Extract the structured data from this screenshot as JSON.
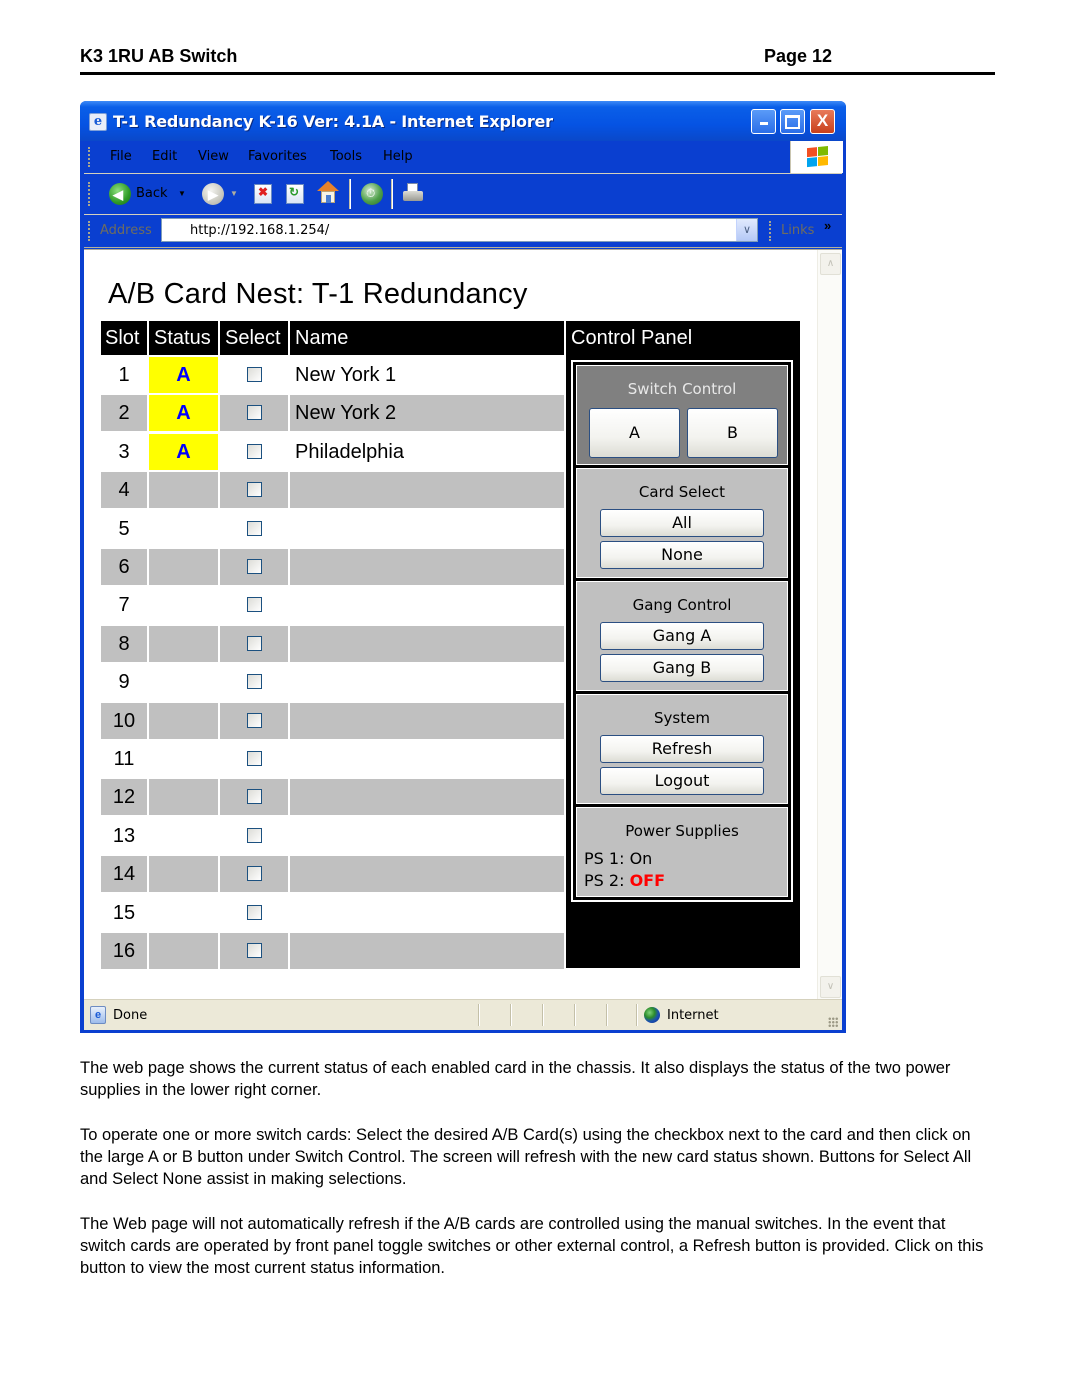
{
  "document": {
    "header_title": "K3 1RU AB Switch",
    "page_label": "Page 12",
    "paragraphs": [
      "The web page shows the current status of each enabled card in the chassis.  It also displays the status of the two power supplies in the lower right corner.",
      "To operate one or more switch cards:  Select the desired A/B Card(s) using the checkbox next to the card and then click on the large A or B button under Switch Control.  The screen will refresh with the new card status shown.  Buttons for Select All and Select None assist in making selections.",
      "The Web page will not automatically refresh if the A/B cards are controlled using the manual switches.  In the event that switch cards are operated by front panel toggle switches or other external control, a Refresh button is provided.  Click on this button to view the most current status information."
    ]
  },
  "browser": {
    "window_title": "T-1 Redundancy K-16 Ver: 4.1A - Internet Explorer",
    "menu": [
      "File",
      "Edit",
      "View",
      "Favorites",
      "Tools",
      "Help"
    ],
    "toolbar": {
      "back_label": "Back",
      "icons": [
        "back-icon",
        "forward-icon",
        "stop-icon",
        "refresh-icon",
        "home-icon",
        "media-icon",
        "print-icon"
      ]
    },
    "address": {
      "label": "Address",
      "value": "http://192.168.1.254/",
      "links_label": "Links",
      "links_chevron": "»"
    },
    "status": {
      "text": "Done",
      "zone": "Internet"
    },
    "window_buttons": {
      "minimize": "_",
      "maximize": "□",
      "close": "X"
    }
  },
  "page": {
    "heading": "A/B Card Nest: T-1 Redundancy",
    "table": {
      "columns": [
        "Slot",
        "Status",
        "Select",
        "Name"
      ],
      "rows": [
        {
          "slot": "1",
          "status": "A",
          "checked": false,
          "name": "New York 1"
        },
        {
          "slot": "2",
          "status": "A",
          "checked": false,
          "name": "New York 2"
        },
        {
          "slot": "3",
          "status": "A",
          "checked": false,
          "name": "Philadelphia"
        },
        {
          "slot": "4",
          "status": "",
          "checked": false,
          "name": ""
        },
        {
          "slot": "5",
          "status": "",
          "checked": false,
          "name": ""
        },
        {
          "slot": "6",
          "status": "",
          "checked": false,
          "name": ""
        },
        {
          "slot": "7",
          "status": "",
          "checked": false,
          "name": ""
        },
        {
          "slot": "8",
          "status": "",
          "checked": false,
          "name": ""
        },
        {
          "slot": "9",
          "status": "",
          "checked": false,
          "name": ""
        },
        {
          "slot": "10",
          "status": "",
          "checked": false,
          "name": ""
        },
        {
          "slot": "11",
          "status": "",
          "checked": false,
          "name": ""
        },
        {
          "slot": "12",
          "status": "",
          "checked": false,
          "name": ""
        },
        {
          "slot": "13",
          "status": "",
          "checked": false,
          "name": ""
        },
        {
          "slot": "14",
          "status": "",
          "checked": false,
          "name": ""
        },
        {
          "slot": "15",
          "status": "",
          "checked": false,
          "name": ""
        },
        {
          "slot": "16",
          "status": "",
          "checked": false,
          "name": ""
        }
      ]
    },
    "control_panel": {
      "title": "Control Panel",
      "switch_control": {
        "title": "Switch Control",
        "button_a": "A",
        "button_b": "B"
      },
      "card_select": {
        "title": "Card Select",
        "all": "All",
        "none": "None"
      },
      "gang_control": {
        "title": "Gang Control",
        "gang_a": "Gang A",
        "gang_b": "Gang B"
      },
      "system": {
        "title": "System",
        "refresh": "Refresh",
        "logout": "Logout"
      },
      "power_supplies": {
        "title": "Power Supplies",
        "ps1_label": "PS 1:",
        "ps1_value": "On",
        "ps2_label": "PS 2:",
        "ps2_value": "OFF"
      }
    }
  },
  "colors": {
    "status_a_bg": "#ffff00",
    "status_a_text": "#0000ff",
    "ps_off": "#ff0000",
    "row_alt": "#c0c0c0",
    "header_bg": "#000000",
    "switch_section_bg": "#808080",
    "xp_title_blue": "#0553e3"
  }
}
